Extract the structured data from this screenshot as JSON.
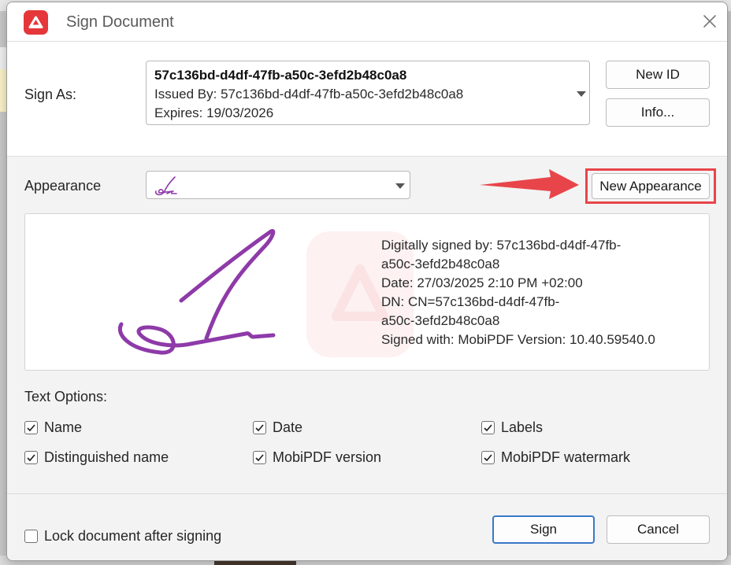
{
  "window": {
    "title": "Sign Document"
  },
  "sign_as": {
    "label": "Sign As:",
    "id": "57c136bd-d4df-47fb-a50c-3efd2b48c0a8",
    "issued_by": "Issued By: 57c136bd-d4df-47fb-a50c-3efd2b48c0a8",
    "expires": "Expires: 19/03/2026",
    "new_id_button": "New ID",
    "info_button": "Info..."
  },
  "appearance": {
    "label": "Appearance",
    "new_appearance_button": "New Appearance"
  },
  "preview": {
    "lines": [
      "Digitally signed by: 57c136bd-d4df-47fb-",
      "a50c-3efd2b48c0a8",
      "Date: 27/03/2025 2:10 PM +02:00",
      "DN: CN=57c136bd-d4df-47fb-",
      "a50c-3efd2b48c0a8",
      "Signed with: MobiPDF Version: 10.40.59540.0"
    ]
  },
  "text_options": {
    "label": "Text Options:",
    "items": [
      {
        "label": "Name",
        "checked": true
      },
      {
        "label": "Date",
        "checked": true
      },
      {
        "label": "Labels",
        "checked": true
      },
      {
        "label": "Distinguished name",
        "checked": true
      },
      {
        "label": "MobiPDF version",
        "checked": true
      },
      {
        "label": "MobiPDF watermark",
        "checked": true
      }
    ]
  },
  "footer": {
    "lock_label": "Lock document after signing",
    "lock_checked": false,
    "sign_button": "Sign",
    "cancel_button": "Cancel"
  },
  "colors": {
    "accent_red": "#e5373a",
    "annotation_red": "#e8454a",
    "signature_purple": "#8e3aa8",
    "primary_border": "#3a78c8"
  },
  "icons": {
    "app_logo": "mobipdf-logo-icon",
    "close": "close-icon",
    "dropdown": "chevron-down-icon",
    "check": "checkmark-icon",
    "annotation": "arrow-annotation-icon"
  }
}
